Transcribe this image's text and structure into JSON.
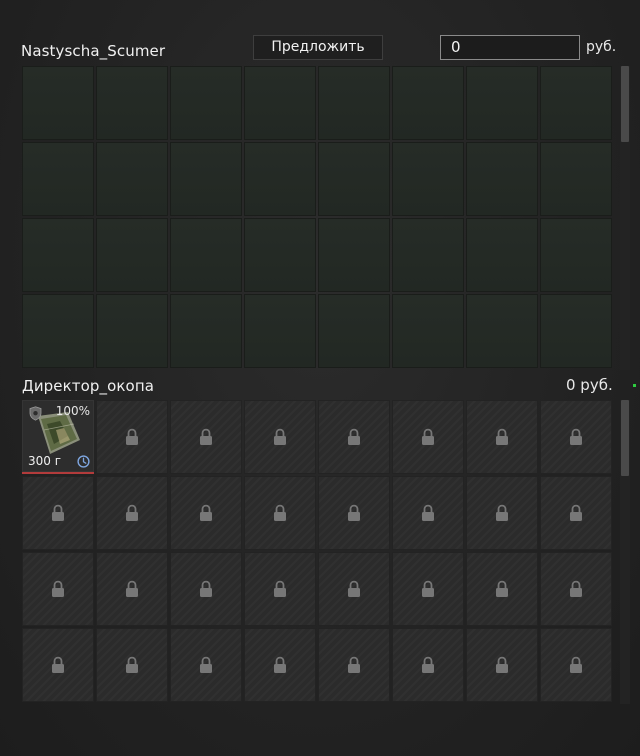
{
  "offer_panel": {
    "player_name": "Nastyscha_Scumer",
    "offer_button_label": "Предложить",
    "money_input_value": "0",
    "currency_label": "руб."
  },
  "player_panel": {
    "player_name": "Директор_окопа",
    "money_label": "0 руб."
  },
  "item": {
    "durability": "100%",
    "weight": "300 г",
    "icons": [
      "shield-icon",
      "clock-icon"
    ],
    "highlight_color": "#b23b3b"
  },
  "icons": {
    "locked_slot": "lock-icon"
  },
  "colors": {
    "background": "#262626",
    "empty_slot": "#252b26",
    "locked_slot": "#2b2b2b",
    "accent_green": "#2ecc40"
  }
}
